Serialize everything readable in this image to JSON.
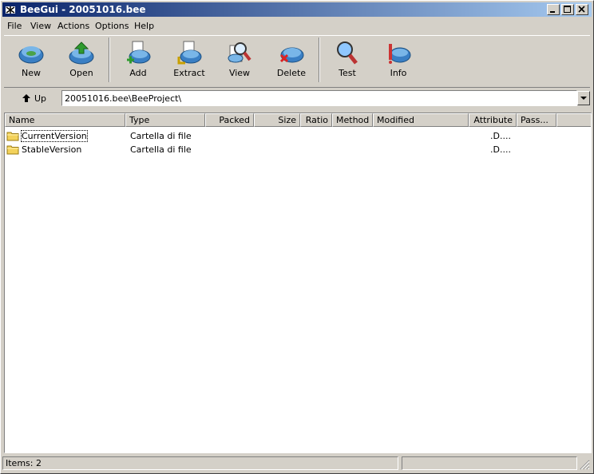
{
  "window": {
    "title": "BeeGui - 20051016.bee"
  },
  "menu": [
    {
      "label": "File"
    },
    {
      "label": "View"
    },
    {
      "label": "Actions"
    },
    {
      "label": "Options"
    },
    {
      "label": "Help"
    }
  ],
  "toolbar": {
    "new": "New",
    "open": "Open",
    "add": "Add",
    "extract": "Extract",
    "view": "View",
    "delete": "Delete",
    "test": "Test",
    "info": "Info"
  },
  "address": {
    "up_label": "Up",
    "path": "20051016.bee\\BeeProject\\"
  },
  "columns": [
    "Name",
    "Type",
    "Packed",
    "Size",
    "Ratio",
    "Method",
    "Modified",
    "Attribute",
    "Pass..."
  ],
  "rows": [
    {
      "name": "CurrentVersion",
      "type": "Cartella di file",
      "attribute": ".D...."
    },
    {
      "name": "StableVersion",
      "type": "Cartella di file",
      "attribute": ".D...."
    }
  ],
  "status": {
    "items": "Items: 2"
  },
  "colors": {
    "title_start": "#0a246a",
    "title_end": "#a6caf0",
    "face": "#d4d0c8"
  }
}
